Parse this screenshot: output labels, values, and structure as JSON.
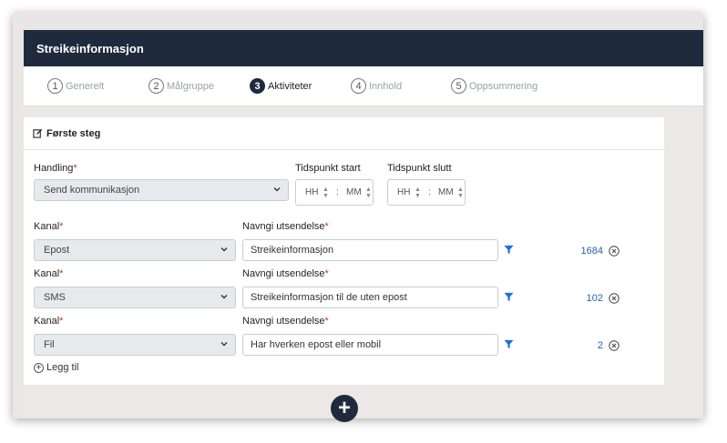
{
  "window": {
    "title": "Streikeinformasjon"
  },
  "steps": [
    {
      "num": "1",
      "label": "Generelt"
    },
    {
      "num": "2",
      "label": "Målgruppe"
    },
    {
      "num": "3",
      "label": "Aktiviteter"
    },
    {
      "num": "4",
      "label": "Innhold"
    },
    {
      "num": "5",
      "label": "Oppsummering"
    }
  ],
  "card": {
    "title": "Første steg"
  },
  "action": {
    "label": "Handling",
    "value": "Send kommunikasjon"
  },
  "time_start": {
    "label": "Tidspunkt start",
    "hh": "HH",
    "mm": "MM",
    "sep": ":"
  },
  "time_end": {
    "label": "Tidspunkt slutt",
    "hh": "HH",
    "mm": "MM",
    "sep": ":"
  },
  "required_mark": "*",
  "rows": [
    {
      "channel_label": "Kanal",
      "channel": "Epost",
      "name_label": "Navngi utsendelse",
      "name": "Streikeinformasjon",
      "count": "1684"
    },
    {
      "channel_label": "Kanal",
      "channel": "SMS",
      "name_label": "Navngi utsendelse",
      "name": "Streikeinformasjon til de uten epost",
      "count": "102"
    },
    {
      "channel_label": "Kanal",
      "channel": "Fil",
      "name_label": "Navngi utsendelse",
      "name": "Har hverken epost eller mobil",
      "count": "2"
    }
  ],
  "add_link": {
    "label": "Legg til"
  },
  "fab": {
    "symbol": "+"
  },
  "colors": {
    "header": "#1f2b3c",
    "link": "#2a5db0",
    "filter": "#1e6fd9",
    "required": "#c0392b"
  }
}
